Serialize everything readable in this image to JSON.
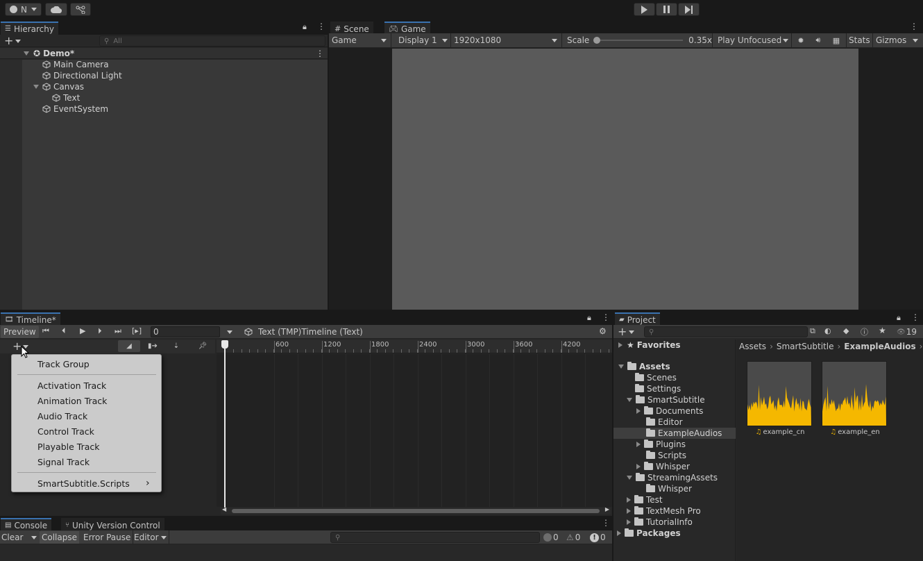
{
  "toolbar": {
    "account_label": "N",
    "play_icon": "play-icon",
    "pause_icon": "pause-icon",
    "step_icon": "step-icon"
  },
  "hierarchy": {
    "tab_label": "Hierarchy",
    "search_placeholder": "All",
    "scene_name": "Demo*",
    "items": [
      {
        "label": "Main Camera"
      },
      {
        "label": "Directional Light"
      },
      {
        "label": "Canvas"
      },
      {
        "label": "Text"
      },
      {
        "label": "EventSystem"
      }
    ]
  },
  "scene_view": {
    "tab_scene": "Scene",
    "tab_game": "Game",
    "game_dropdown": "Game",
    "display_dropdown": "Display 1",
    "resolution_dropdown": "1920x1080",
    "scale_label": "Scale",
    "scale_value": "0.35x",
    "scale_fraction": 0.02,
    "play_mode_dropdown": "Play Unfocused",
    "stats_label": "Stats",
    "gizmos_label": "Gizmos"
  },
  "timeline": {
    "tab_label": "Timeline*",
    "preview_label": "Preview",
    "frame_value": "0",
    "breadcrumb": "Text (TMP)Timeline (Text)",
    "ruler_labels": [
      "600",
      "1200",
      "1800",
      "2400",
      "3000",
      "3600",
      "4200"
    ]
  },
  "add_track_menu": {
    "items_group1": [
      "Track Group"
    ],
    "items_group2": [
      "Activation Track",
      "Animation Track",
      "Audio Track",
      "Control Track",
      "Playable Track",
      "Signal Track"
    ],
    "items_group3": [
      "SmartSubtitle.Scripts"
    ],
    "submenu_arrow": "›"
  },
  "console": {
    "tab_console": "Console",
    "tab_version_control": "Unity Version Control",
    "clear_label": "Clear",
    "collapse_label": "Collapse",
    "error_pause_label": "Error Pause",
    "editor_label": "Editor",
    "info_count": "0",
    "warning_count": "0",
    "error_count": "0"
  },
  "project": {
    "tab_label": "Project",
    "hidden_count": "19",
    "favorites_label": "Favorites",
    "tree": [
      {
        "label": "Assets"
      },
      {
        "label": "Scenes"
      },
      {
        "label": "Settings"
      },
      {
        "label": "SmartSubtitle"
      },
      {
        "label": "Documents"
      },
      {
        "label": "Editor"
      },
      {
        "label": "ExampleAudios"
      },
      {
        "label": "Plugins"
      },
      {
        "label": "Scripts"
      },
      {
        "label": "Whisper"
      },
      {
        "label": "StreamingAssets"
      },
      {
        "label": "Whisper"
      },
      {
        "label": "Test"
      },
      {
        "label": "TextMesh Pro"
      },
      {
        "label": "TutorialInfo"
      },
      {
        "label": "Packages"
      }
    ],
    "breadcrumb": [
      "Assets",
      "SmartSubtitle",
      "ExampleAudios"
    ],
    "files": [
      {
        "label": "example_cn"
      },
      {
        "label": "example_en"
      }
    ]
  },
  "colors": {
    "accent": "#3a72b0",
    "waveform": "#f5b800",
    "game_view": "#5a5a5a",
    "menu_bg": "#cbcbcb"
  }
}
